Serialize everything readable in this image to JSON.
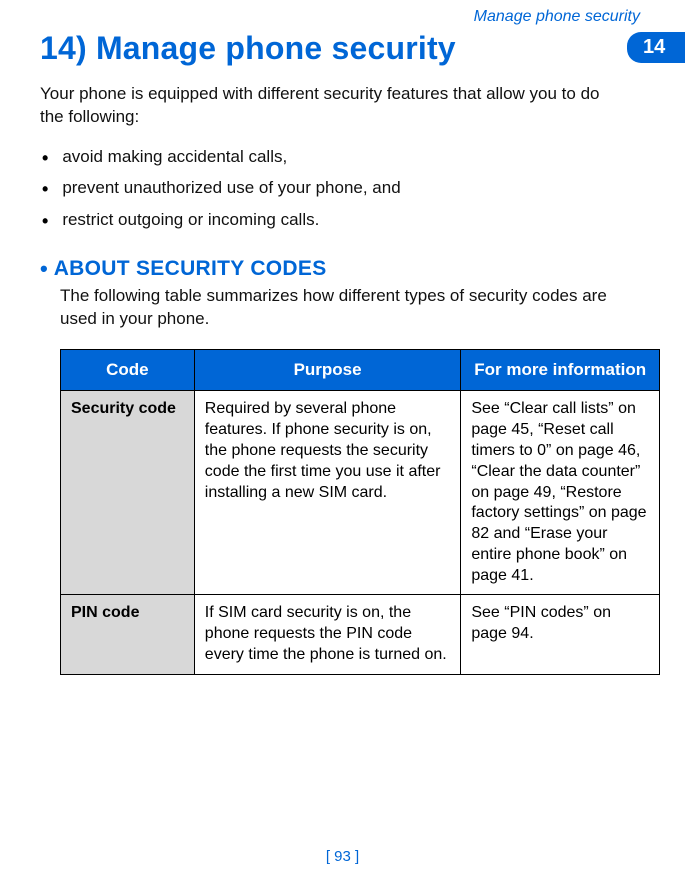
{
  "running_head": "Manage phone security",
  "chapter": {
    "number_label": "14)",
    "title_text": "Manage phone security",
    "tab": "14"
  },
  "intro": "Your phone is equipped with different security features that allow you to do the following:",
  "features": [
    "avoid making accidental calls,",
    "prevent unauthorized use of your phone, and",
    "restrict outgoing or incoming calls."
  ],
  "section": {
    "title": "ABOUT SECURITY CODES",
    "intro": "The following table summarizes how different types of security codes are used in your phone."
  },
  "table": {
    "headers": {
      "code": "Code",
      "purpose": "Purpose",
      "more": "For more information"
    },
    "rows": [
      {
        "code": "Security code",
        "purpose": "Required by several phone features. If phone security is on, the phone requests the security code the first time you use it after installing a new SIM card.",
        "more": "See “Clear call lists” on page 45, “Reset call timers to 0” on page 46, “Clear the data counter” on page 49, “Restore factory settings” on page 82 and “Erase your entire phone book” on page 41."
      },
      {
        "code": "PIN code",
        "purpose": "If SIM card security is on, the phone requests the PIN code every time the phone is turned on.",
        "more": "See “PIN codes” on page 94."
      }
    ]
  },
  "page_number": "[ 93 ]"
}
